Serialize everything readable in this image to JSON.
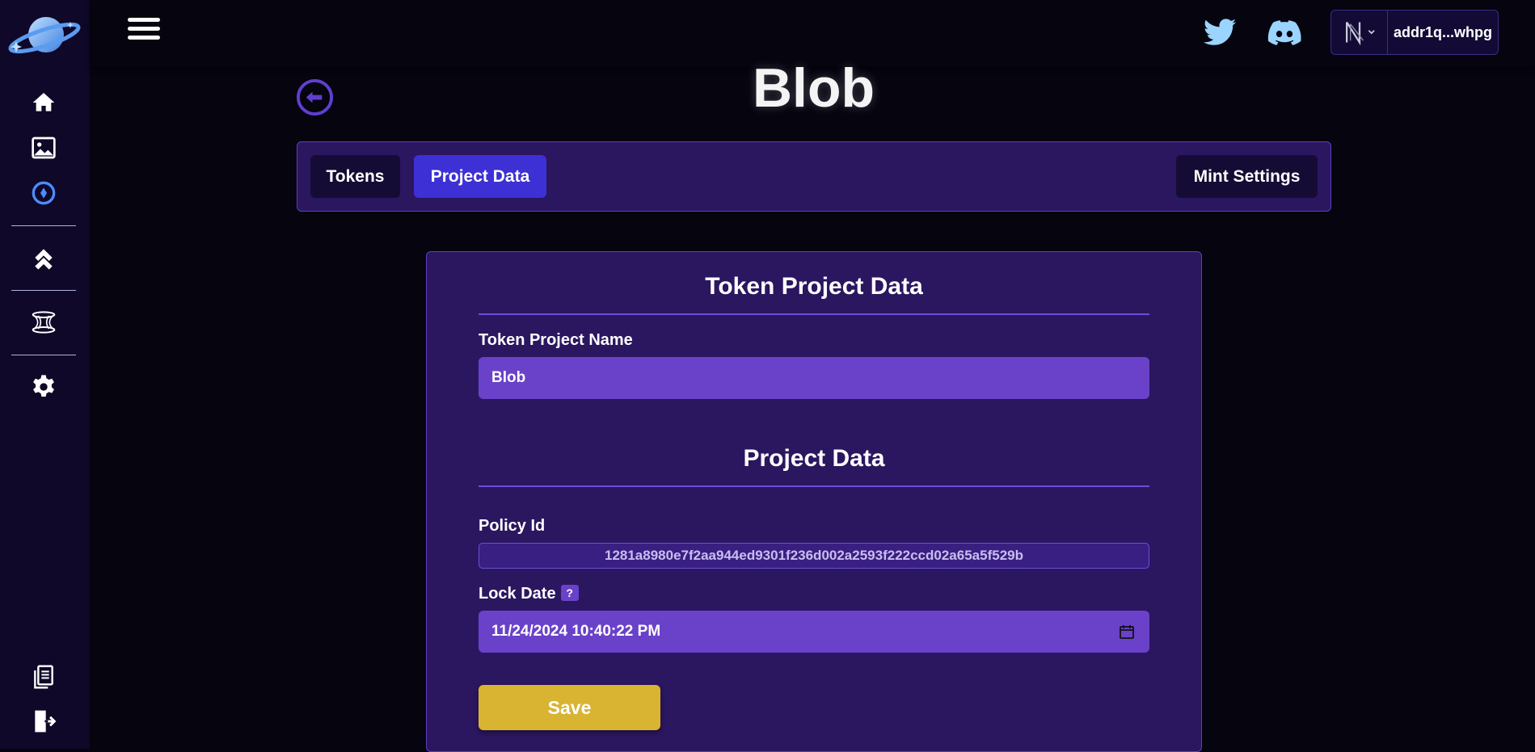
{
  "page": {
    "title": "Blob"
  },
  "topbar": {
    "icons": [
      "menu-icon",
      "twitter-icon",
      "discord-icon",
      "wallet-icon"
    ],
    "wallet_address": "addr1q...whpg"
  },
  "sidebar": {
    "items": [
      "home-icon",
      "gallery-icon",
      "compass-icon",
      "chevrons-up-icon",
      "wormhole-icon",
      "settings-icon",
      "documents-icon",
      "logout-icon"
    ],
    "active_color": "#4b8cff"
  },
  "tabs": {
    "tokens": "Tokens",
    "project_data": "Project Data",
    "mint_settings": "Mint Settings",
    "active": "Project Data"
  },
  "card": {
    "section1_title": "Token Project Data",
    "name_label": "Token Project Name",
    "name_value": "Blob",
    "section2_title": "Project Data",
    "policy_label": "Policy Id",
    "policy_value": "1281a8980e7f2aa944ed9301f236d002a2593f222ccd02a65a5f529b",
    "lock_label": "Lock Date",
    "lock_help": "?",
    "lock_value": "11/24/2024 10:40:22 PM",
    "save_label": "Save"
  },
  "colors": {
    "background": "#05040f",
    "panel": "#2b1660",
    "active_tab": "#3d30d4",
    "input": "#6a41c9",
    "save": "#d9b432"
  }
}
